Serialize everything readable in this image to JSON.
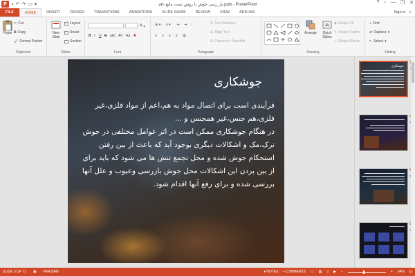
{
  "window": {
    "title": "باز رسی جوش با روش تست مایع نافذ.pptx - PowerPoint",
    "help": "?",
    "minimize": "—",
    "restore": "❐",
    "close": "✕",
    "app_logo": "P"
  },
  "tabs": [
    "FILE",
    "HOME",
    "INSERT",
    "DESIGN",
    "TRANSITIONS",
    "ANIMATIONS",
    "SLIDE SHOW",
    "REVIEW",
    "VIEW",
    "ADD-INS"
  ],
  "active_tab": "HOME",
  "signin": "Sign in",
  "ribbon": {
    "clipboard": {
      "paste": "Paste",
      "cut": "Cut",
      "copy": "Copy",
      "format_painter": "Format Painter",
      "label": "Clipboard"
    },
    "slides": {
      "new_slide": "New Slide",
      "layout": "Layout",
      "reset": "Reset",
      "section": "Section",
      "label": "Slides"
    },
    "font": {
      "bold": "B",
      "italic": "I",
      "underline": "U",
      "strike": "S",
      "shadow": "abc",
      "spacing": "AV",
      "case": "Aa",
      "color": "A",
      "label": "Font"
    },
    "paragraph": {
      "text_direction": "Text Direction",
      "align_text": "Align Text",
      "smartart": "Convert to SmartArt",
      "label": "Paragraph"
    },
    "drawing": {
      "arrange": "Arrange",
      "quick_styles": "Quick Styles",
      "shape_fill": "Shape Fill",
      "shape_outline": "Shape Outline",
      "shape_effects": "Shape Effects",
      "label": "Drawing"
    },
    "editing": {
      "find": "Find",
      "replace": "Replace",
      "select": "Select",
      "label": "Editing"
    }
  },
  "slide": {
    "title": "جوشکاری",
    "body": [
      "فرآیندی است برای اتصال مواد به هم،اعم از مواد فلزی،غیر فلزی،هم جنس،غیر همجنس و ...",
      "در هنگام جوشکاری ممکن است در اثر عوامل مختلفی در جوش ترک،مک و اشکالات دیگری بوجود آید که باعث از بین رفتن استحکام جوش شده و محل تجمع تنش ها می شود که باید برای از بین بردن این اشکالات محل جوش بازرسی وعیوب و علل آنها بررسی شده و برای رفع آنها اقدام شود."
    ]
  },
  "thumbnails": [
    {
      "number": "3",
      "star": "★",
      "title": "جوشکاری",
      "selected": true
    },
    {
      "number": "4",
      "star": "★",
      "title": "",
      "selected": false
    },
    {
      "number": "5",
      "star": "★",
      "title": "",
      "selected": false
    },
    {
      "number": "6",
      "star": "★",
      "title": "",
      "selected": false
    }
  ],
  "status": {
    "slide_info": "SLIDE 3 OF 71",
    "language": "PERSIAN",
    "notes": "NOTES",
    "comments": "COMMENTS",
    "zoom": "34%"
  },
  "colors": {
    "accent": "#d24726",
    "ribbon_bg": "#f5f5f5",
    "workspace": "#e4e4e4"
  }
}
